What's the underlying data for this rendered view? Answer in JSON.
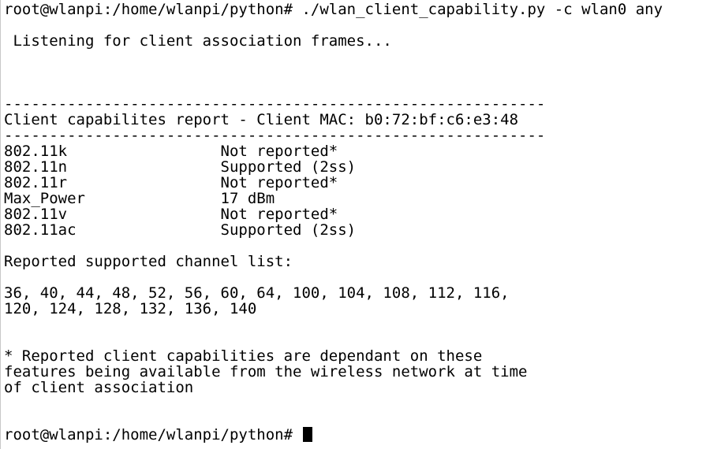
{
  "terminal": {
    "command_line": "root@wlanpi:/home/wlanpi/python# ./wlan_client_capability.py -c wlan0 any",
    "listening": " Listening for client association frames...",
    "separator": "------------------------------------------------------------",
    "report_title": "Client capabilites report - Client MAC: b0:72:bf:c6:e3:48",
    "capabilities": [
      "802.11k                 Not reported*",
      "802.11n                 Supported (2ss)",
      "802.11r                 Not reported*",
      "Max_Power               17 dBm",
      "802.11v                 Not reported*",
      "802.11ac                Supported (2ss)"
    ],
    "channel_heading": "Reported supported channel list:",
    "channels": [
      "36, 40, 44, 48, 52, 56, 60, 64, 100, 104, 108, 112, 116,",
      "120, 124, 128, 132, 136, 140"
    ],
    "footnote": [
      "* Reported client capabilities are dependant on these",
      "features being available from the wireless network at time",
      "of client association"
    ],
    "prompt": "root@wlanpi:/home/wlanpi/python# "
  },
  "colors": {
    "background": "#ffffff",
    "text": "#000000"
  }
}
